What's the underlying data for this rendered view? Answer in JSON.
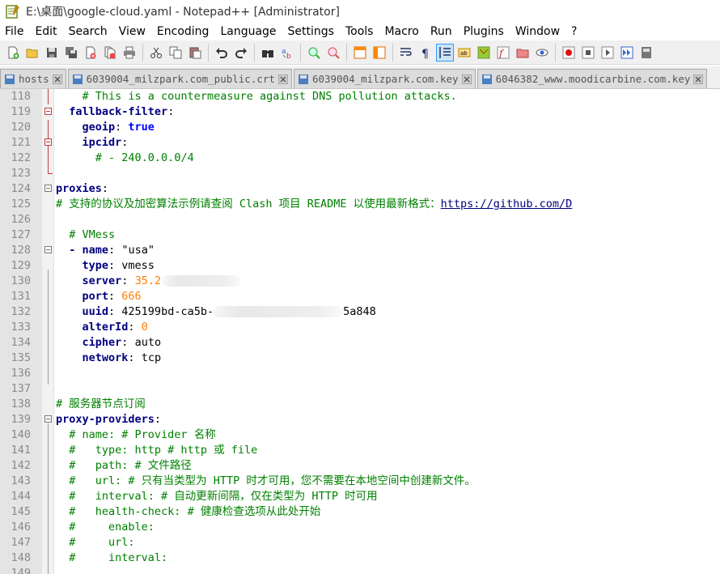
{
  "window": {
    "title": "E:\\桌面\\google-cloud.yaml - Notepad++ [Administrator]"
  },
  "menu": [
    "File",
    "Edit",
    "Search",
    "View",
    "Encoding",
    "Language",
    "Settings",
    "Tools",
    "Macro",
    "Run",
    "Plugins",
    "Window",
    "?"
  ],
  "toolbar": {
    "icons": [
      "new-file-icon",
      "open-file-icon",
      "save-icon",
      "save-all-icon",
      "close-icon",
      "close-all-icon",
      "print-icon",
      "cut-icon",
      "copy-icon",
      "paste-icon",
      "undo-icon",
      "redo-icon",
      "find-icon",
      "replace-icon",
      "zoom-in-icon",
      "zoom-out-icon",
      "sync-vertical-icon",
      "sync-horizontal-icon",
      "word-wrap-icon",
      "show-all-chars-icon",
      "indent-guide-icon",
      "user-language-icon",
      "document-map-icon",
      "function-list-icon",
      "folder-workspace-icon",
      "monitoring-icon",
      "record-macro-icon",
      "stop-record-icon",
      "play-macro-icon",
      "run-macro-multiple-icon",
      "save-macro-icon"
    ]
  },
  "tabs": [
    {
      "label": "hosts",
      "active": false
    },
    {
      "label": "6039004_milzpark.com_public.crt",
      "active": false
    },
    {
      "label": "6039004_milzpark.com.key",
      "active": false
    },
    {
      "label": "6046382_www.moodicarbine.com.key",
      "active": false
    }
  ],
  "editor": {
    "lines": [
      {
        "n": "118",
        "text": "    # This is a countermeasure against DNS pollution attacks."
      },
      {
        "n": "119",
        "text": "  fallback-filter:"
      },
      {
        "n": "120",
        "text": "    geoip: true"
      },
      {
        "n": "121",
        "text": "    ipcidr:"
      },
      {
        "n": "122",
        "text": "      # - 240.0.0.0/4"
      },
      {
        "n": "123",
        "text": ""
      },
      {
        "n": "124",
        "text": "proxies:"
      },
      {
        "n": "125",
        "text": "# 支持的协议及加密算法示例请查阅 Clash 项目 README 以使用最新格式：https://github.com/D"
      },
      {
        "n": "126",
        "text": ""
      },
      {
        "n": "127",
        "text": "  # VMess"
      },
      {
        "n": "128",
        "text": "  - name: \"usa\""
      },
      {
        "n": "129",
        "text": "    type: vmess"
      },
      {
        "n": "130",
        "text": "    server: 35.2"
      },
      {
        "n": "131",
        "text": "    port: 666"
      },
      {
        "n": "132",
        "text": "    uuid: 425199bd-ca5b-"
      },
      {
        "n": "133",
        "text": "    alterId: 0"
      },
      {
        "n": "134",
        "text": "    cipher: auto"
      },
      {
        "n": "135",
        "text": "    network: tcp"
      },
      {
        "n": "136",
        "text": ""
      },
      {
        "n": "137",
        "text": ""
      },
      {
        "n": "138",
        "text": "# 服务器节点订阅"
      },
      {
        "n": "139",
        "text": "proxy-providers:"
      },
      {
        "n": "140",
        "text": "  # name: # Provider 名称"
      },
      {
        "n": "141",
        "text": "  #   type: http # http 或 file"
      },
      {
        "n": "142",
        "text": "  #   path: # 文件路径"
      },
      {
        "n": "143",
        "text": "  #   url: # 只有当类型为 HTTP 时才可用，您不需要在本地空间中创建新文件。"
      },
      {
        "n": "144",
        "text": "  #   interval: # 自动更新间隔，仅在类型为 HTTP 时可用"
      },
      {
        "n": "145",
        "text": "  #   health-check: # 健康检查选项从此处开始"
      },
      {
        "n": "146",
        "text": "  #     enable:"
      },
      {
        "n": "147",
        "text": "  #     url:"
      },
      {
        "n": "148",
        "text": "  #     interval:"
      },
      {
        "n": "149",
        "text": ""
      }
    ],
    "parts": {
      "l118": "# This is a countermeasure against DNS pollution attacks.",
      "l119_key": "fallback-filter",
      "l120_key": "geoip",
      "l120_val": "true",
      "l121_key": "ipcidr",
      "l122": "# - 240.0.0.0/4",
      "l124_key": "proxies",
      "l125_comment": "# 支持的协议及加密算法示例请查阅 Clash 项目 README 以使用最新格式：",
      "l125_url": "https://github.com/D",
      "l127": "# VMess",
      "l128_key": "name",
      "l128_val": "\"usa\"",
      "l129_key": "type",
      "l129_val": "vmess",
      "l130_key": "server",
      "l130_val": "35.2",
      "l131_key": "port",
      "l131_val": "666",
      "l132_key": "uuid",
      "l132_val_a": "425199bd-ca5b-",
      "l132_val_b": "5a848",
      "l133_key": "alterId",
      "l133_val": "0",
      "l134_key": "cipher",
      "l134_val": "auto",
      "l135_key": "network",
      "l135_val": "tcp",
      "l138": "# 服务器节点订阅",
      "l139_key": "proxy-providers",
      "l140": "# name: # Provider 名称",
      "l141": "#   type: http # http 或 file",
      "l142": "#   path: # 文件路径",
      "l143": "#   url: # 只有当类型为 HTTP 时才可用，您不需要在本地空间中创建新文件。",
      "l144": "#   interval: # 自动更新间隔，仅在类型为 HTTP 时可用",
      "l145": "#   health-check: # 健康检查选项从此处开始",
      "l146": "#     enable:",
      "l147": "#     url:",
      "l148": "#     interval:"
    }
  },
  "colors": {
    "comment": "#008000",
    "key": "#000080",
    "number": "#ff8000",
    "boolean": "#0000ff",
    "fold_marker": "#c43b3b",
    "gutter": "#e4e4e4"
  }
}
